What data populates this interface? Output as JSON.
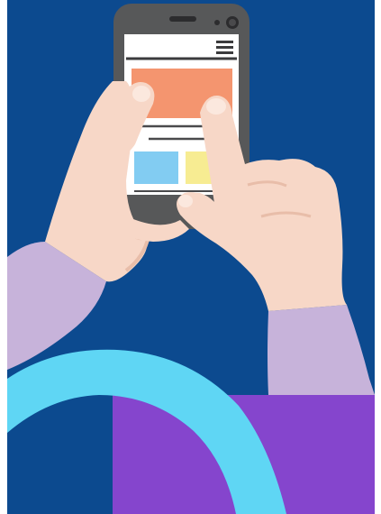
{
  "illustration": {
    "subject": "hands-holding-smartphone",
    "colors": {
      "background": "#0c4a8f",
      "phone_body": "#575859",
      "screen": "#ffffff",
      "hero_block": "#f4956f",
      "tile_left": "#82ccf2",
      "tile_right": "#f7ec92",
      "skin": "#f7d7c7",
      "skin_shadow": "#e8bda9",
      "sleeve": "#c7b3da",
      "ring": "#5fd6f4",
      "purple_block": "#8545cd",
      "edge_white": "#ffffff"
    },
    "icons": [
      "menu-icon",
      "camera-icon",
      "speaker-icon"
    ]
  }
}
